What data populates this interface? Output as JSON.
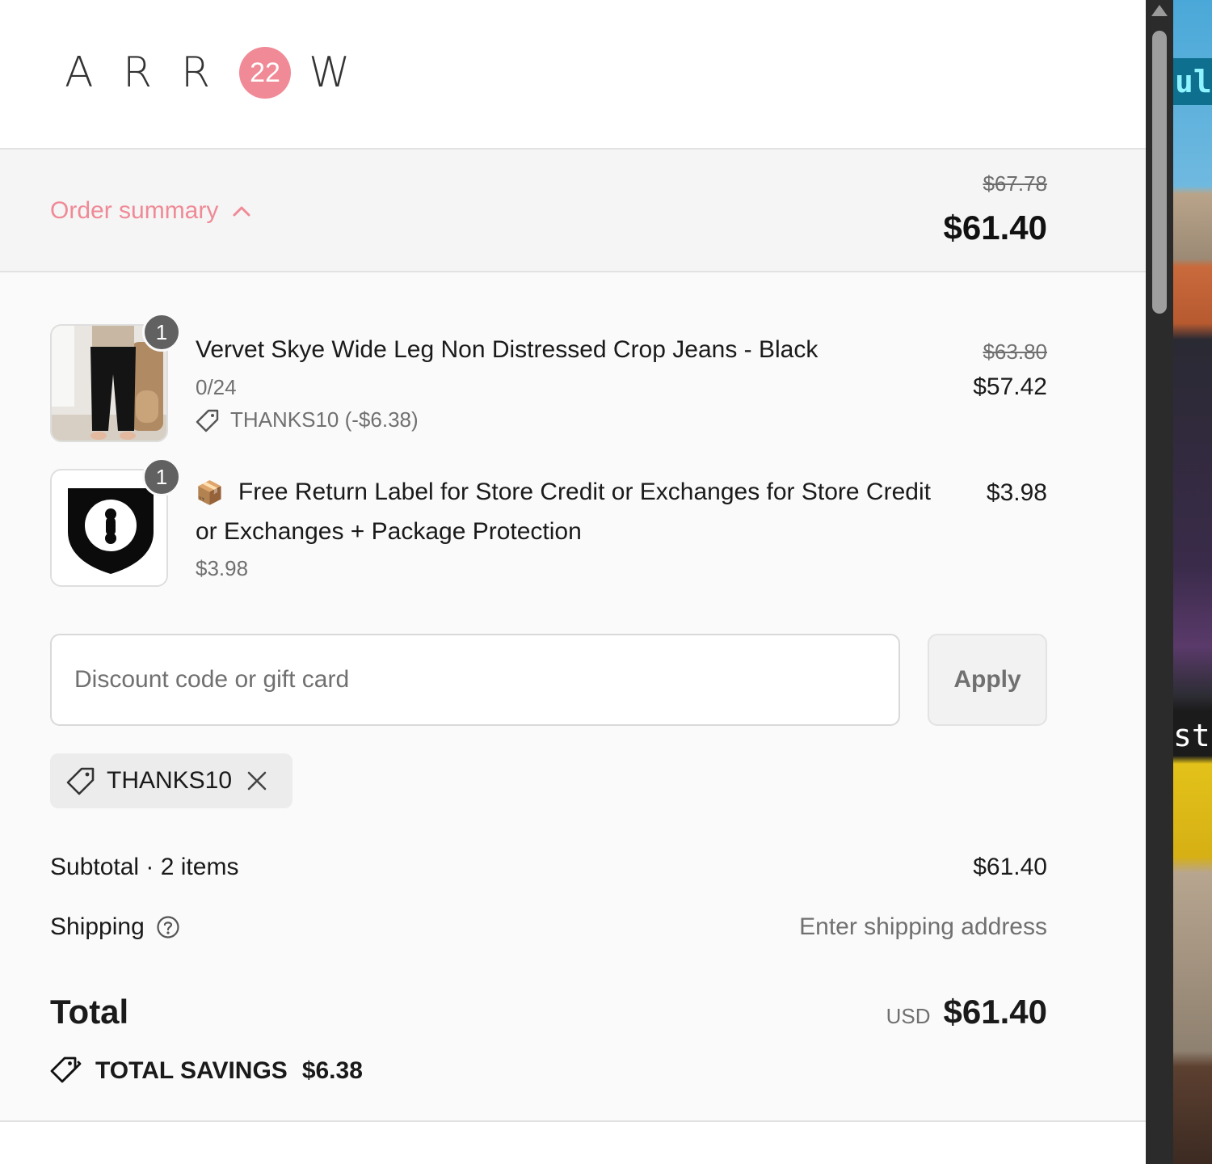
{
  "brand": {
    "letters": [
      "A",
      "R",
      "R"
    ],
    "badge": "22",
    "last_letter": "W"
  },
  "summary": {
    "toggle_label": "Order summary",
    "original_total": "$67.78",
    "total": "$61.40"
  },
  "items": [
    {
      "quantity": "1",
      "name": "Vervet Skye Wide Leg Non Distressed Crop Jeans - Black",
      "variant": "0/24",
      "discount": "THANKS10 (-$6.38)",
      "original_price": "$63.80",
      "price": "$57.42"
    },
    {
      "quantity": "1",
      "emoji": "📦",
      "name_line1": "Free Return Label for Store Credit or Exchanges for Store Credit",
      "name_line2": "or Exchanges + Package Protection",
      "variant": "$3.98",
      "price": "$3.98"
    }
  ],
  "discount_form": {
    "placeholder": "Discount code or gift card",
    "apply_label": "Apply",
    "applied_code": "THANKS10"
  },
  "totals": {
    "subtotal_label": "Subtotal · 2 items",
    "subtotal_value": "$61.40",
    "shipping_label": "Shipping",
    "shipping_value": "Enter shipping address",
    "total_label": "Total",
    "currency": "USD",
    "total_value": "$61.40",
    "savings_label": "TOTAL SAVINGS",
    "savings_value": "$6.38"
  },
  "background_window": {
    "text_top": "ulti",
    "text_bottom": "sta"
  }
}
